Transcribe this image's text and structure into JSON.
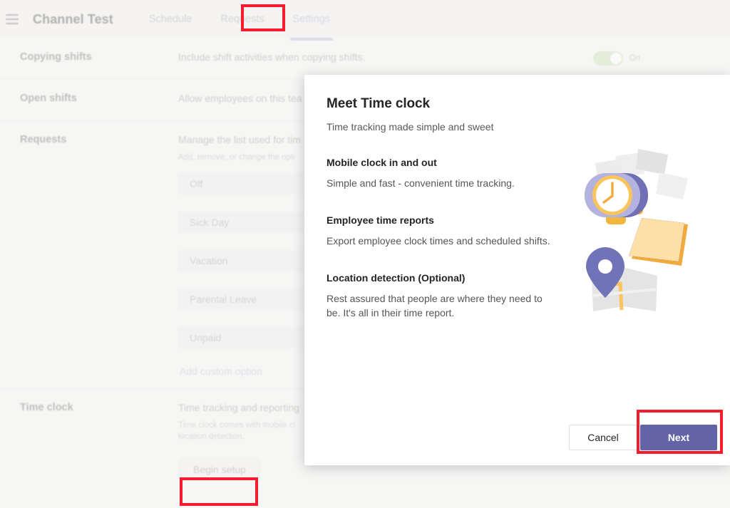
{
  "header": {
    "menu_icon": "hamburger-icon",
    "title": "Channel Test",
    "tabs": [
      {
        "label": "Schedule",
        "active": false
      },
      {
        "label": "Requests",
        "active": false
      },
      {
        "label": "Settings",
        "active": true
      }
    ]
  },
  "settings": {
    "rows": [
      {
        "label": "Copying shifts",
        "description": "Include shift activities when copying shifts.",
        "toggle": {
          "state": "on",
          "label": "On",
          "color": "#cfe3bd"
        }
      },
      {
        "label": "Open shifts",
        "description": "Allow employees on this tea"
      },
      {
        "label": "Requests",
        "description": "Manage the list used for tim",
        "sub": "Add, remove, or change the opti",
        "options": [
          "Off",
          "Sick Day",
          "Vacation",
          "Parental Leave",
          "Unpaid"
        ],
        "add_custom_label": "Add custom option"
      },
      {
        "label": "Time clock",
        "description": "Time tracking and reporting",
        "sub": "Time clock comes with mobile cl\nlocation detection.",
        "button_label": "Begin setup"
      }
    ]
  },
  "modal": {
    "title": "Meet Time clock",
    "subtitle": "Time tracking made simple and sweet",
    "features": [
      {
        "title": "Mobile clock in and out",
        "desc": "Simple and fast - convenient time tracking."
      },
      {
        "title": "Employee time reports",
        "desc": "Export employee clock times and scheduled shifts."
      },
      {
        "title": "Location detection (Optional)",
        "desc": "Rest assured that people are where they need to be. It's all in their time report."
      }
    ],
    "illustration_name": "time-clock-illustration",
    "cancel_label": "Cancel",
    "next_label": "Next",
    "next_color": "#6264a7"
  },
  "annotations": {
    "color": "#f41c2d",
    "boxes": [
      "settings-tab",
      "begin-setup-button",
      "next-button"
    ]
  }
}
